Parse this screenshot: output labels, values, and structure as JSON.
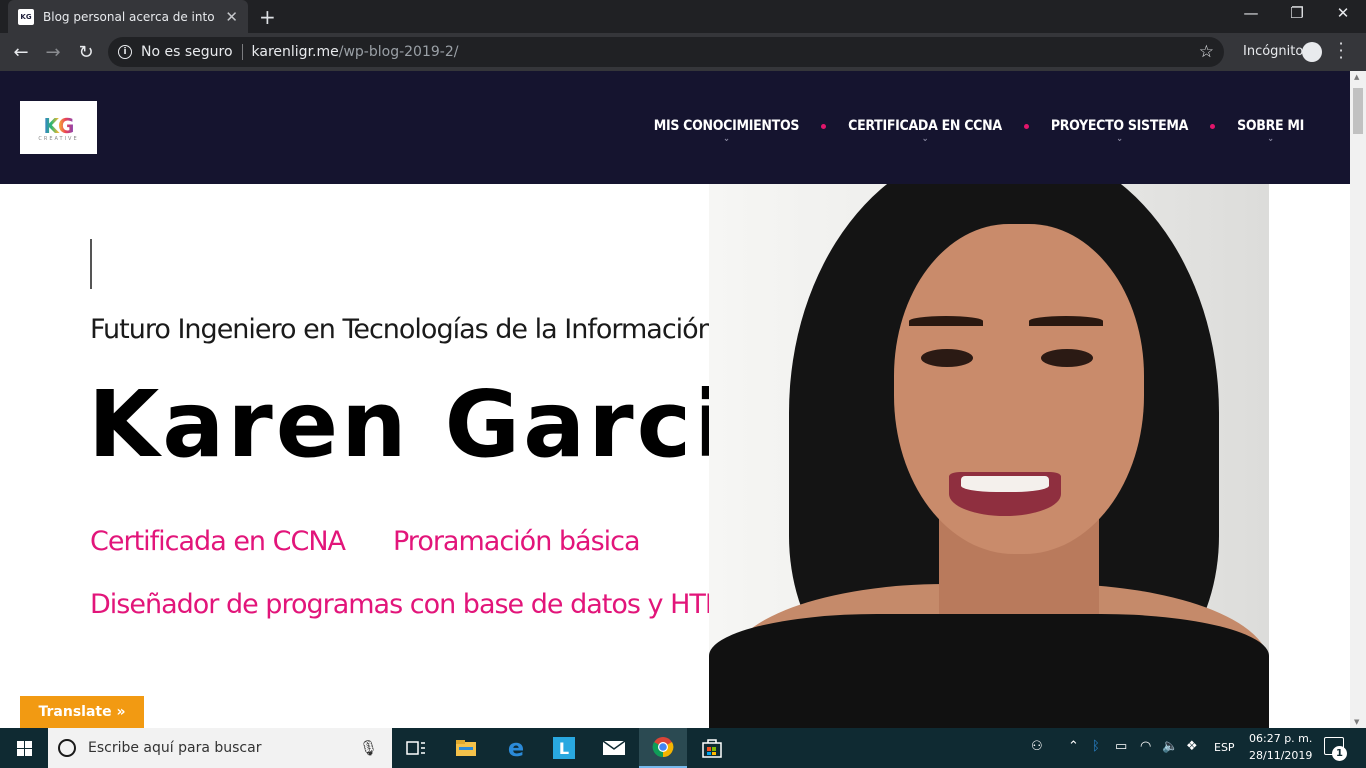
{
  "browser": {
    "tab_title": "Blog personal acerca de into a las",
    "tab_favicon_text": "KG",
    "new_tab": "+",
    "close_tab": "✕",
    "minimize": "—",
    "restore": "❐",
    "close_window": "✕",
    "security_label": "No es seguro",
    "url_host": "karenligr.me",
    "url_path": "/wp-blog-2019-2/",
    "incognito_label": "Incógnito"
  },
  "site": {
    "logo_mark": "KG",
    "logo_sub": "CREATIVE",
    "menu": [
      {
        "label": "MIS CONOCIMIENTOS"
      },
      {
        "label": "CERTIFICADA EN CCNA"
      },
      {
        "label": "PROYECTO SISTEMA"
      },
      {
        "label": "SOBRE MI"
      }
    ],
    "hero": {
      "subtitle": "Futuro Ingeniero en Tecnologías de la Información",
      "name": "Karen Garcia",
      "skills": [
        "Certificada en CCNA",
        "Proramación básica",
        "Diseñador de programas con base de datos y HTML"
      ]
    },
    "translate_label": "Translate »"
  },
  "taskbar": {
    "search_placeholder": "Escribe aquí para buscar",
    "language": "ESP",
    "time": "06:27 p. m.",
    "date": "28/11/2019",
    "notification_count": "1"
  },
  "colors": {
    "header_bg": "#15142f",
    "accent_pink": "#e2157a",
    "translate_orange": "#f29a12",
    "taskbar_bg": "#0f2a32"
  }
}
